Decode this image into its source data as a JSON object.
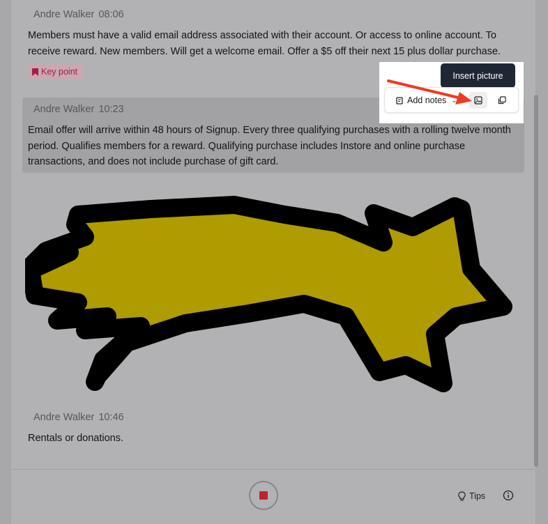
{
  "messages": [
    {
      "author": "Andre Walker",
      "time": "08:06",
      "lines": [
        "Members must have a valid email address associated with their account. Or access to online account. To",
        "receive reward. New members. Will get a welcome email. Offer a $5 off their next 15 plus dollar purchase."
      ],
      "tag": "Key point"
    },
    {
      "author": "Andre Walker",
      "time": "10:23",
      "lines": [
        "Email offer will arrive within 48 hours of Signup. Every three qualifying purchases with a rolling twelve month",
        "period. Qualifies members for a reward. Qualifying purchase includes Instore and online purchase",
        "transactions, and does not include purchase of gift card."
      ]
    },
    {
      "author": "Andre Walker",
      "time": "10:46",
      "lines": [
        "Rentals or donations."
      ]
    }
  ],
  "toolbar": {
    "add_notes_label": "Add notes",
    "tooltip": "Insert picture",
    "icons": [
      "notes-icon",
      "chevron-down-icon",
      "image-icon",
      "copy-icon"
    ]
  },
  "drawing": {
    "shape": "shooting-star",
    "fill_color": "#ae9c00",
    "stroke_color": "#000000"
  },
  "footer": {
    "tips_label": "Tips",
    "record_color": "#b8262e",
    "icons": [
      "stop-icon",
      "lightbulb-icon",
      "info-icon"
    ]
  },
  "annotation": {
    "arrow_color": "#f03a1f"
  }
}
